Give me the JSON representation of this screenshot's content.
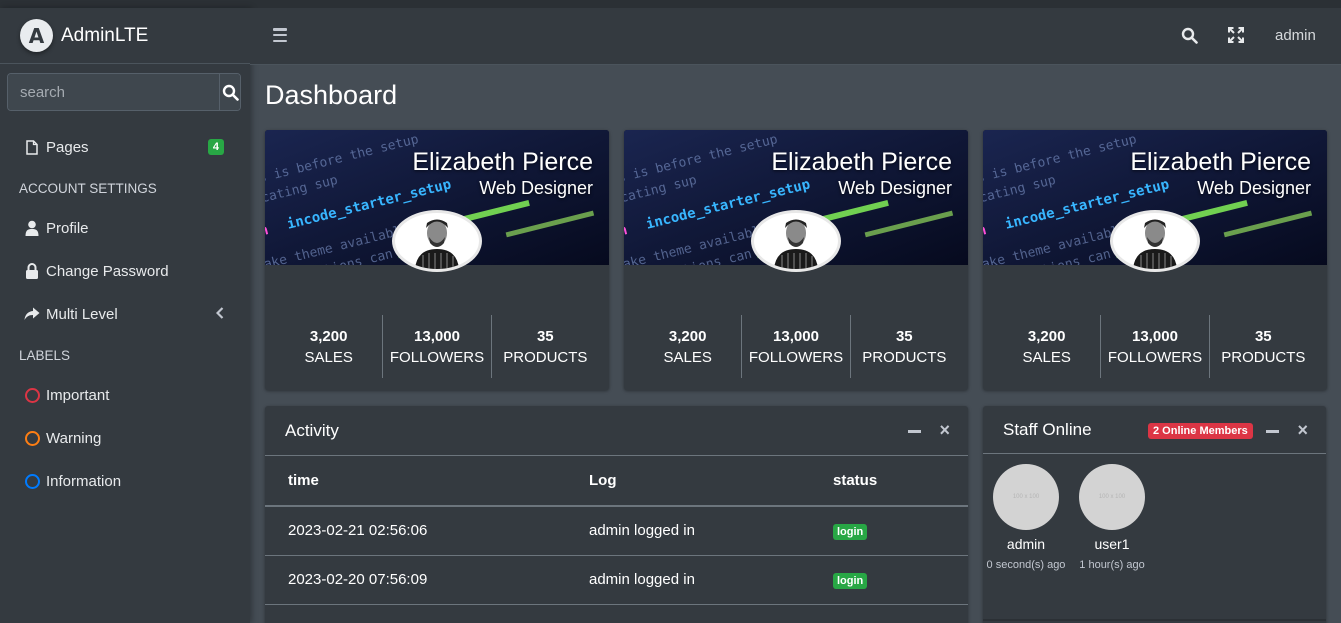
{
  "brand": {
    "logo_letter": "A",
    "name_bold": "Admin",
    "name_light": "LTE"
  },
  "sidebar": {
    "search_placeholder": "search",
    "pages": {
      "label": "Pages",
      "badge": "4"
    },
    "header_account": "ACCOUNT SETTINGS",
    "profile": "Profile",
    "change_password": "Change Password",
    "multi_level": "Multi Level",
    "header_labels": "LABELS",
    "labels": [
      {
        "label": "Important",
        "color": "#dc3545"
      },
      {
        "label": "Warning",
        "color": "#fd7e14"
      },
      {
        "label": "Information",
        "color": "#007bff"
      }
    ]
  },
  "header": {
    "user": "admin"
  },
  "page_title": "Dashboard",
  "profile_cards": [
    {
      "name": "Elizabeth Pierce",
      "role": "Web Designer",
      "stats": [
        {
          "num": "3,200",
          "label": "SALES"
        },
        {
          "num": "13,000",
          "label": "FOLLOWERS"
        },
        {
          "num": "35",
          "label": "PRODUCTS"
        }
      ]
    },
    {
      "name": "Elizabeth Pierce",
      "role": "Web Designer",
      "stats": [
        {
          "num": "3,200",
          "label": "SALES"
        },
        {
          "num": "13,000",
          "label": "FOLLOWERS"
        },
        {
          "num": "35",
          "label": "PRODUCTS"
        }
      ]
    },
    {
      "name": "Elizabeth Pierce",
      "role": "Web Designer",
      "stats": [
        {
          "num": "3,200",
          "label": "SALES"
        },
        {
          "num": "13,000",
          "label": "FOLLOWERS"
        },
        {
          "num": "35",
          "label": "PRODUCTS"
        }
      ]
    }
  ],
  "activity": {
    "title": "Activity",
    "columns": [
      "time",
      "Log",
      "status"
    ],
    "rows": [
      {
        "time": "2023-02-21 02:56:06",
        "log": "admin logged in",
        "status": "login"
      },
      {
        "time": "2023-02-20 07:56:09",
        "log": "admin logged in",
        "status": "login"
      },
      {
        "time": "",
        "log": "",
        "status": ""
      }
    ]
  },
  "staff": {
    "title": "Staff Online",
    "badge": "2 Online Members",
    "placeholder_text": "100 x 100",
    "members": [
      {
        "name": "admin",
        "time": "0 second(s) ago"
      },
      {
        "name": "user1",
        "time": "1 hour(s) ago"
      }
    ]
  },
  "colors": {
    "sidebar_bg": "#343a40",
    "content_bg": "#454d55",
    "success": "#28a745",
    "danger": "#dc3545"
  }
}
